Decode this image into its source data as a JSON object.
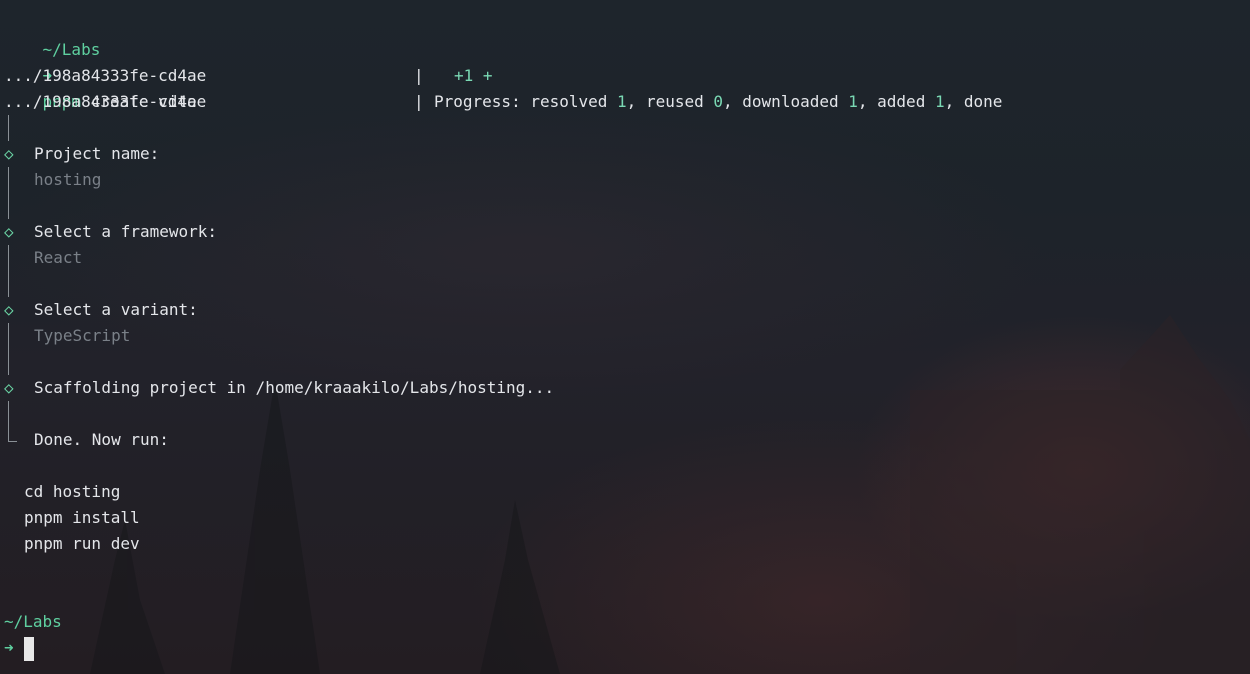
{
  "prompt_dir_1": "~/Labs",
  "cmd_arrow": "➜",
  "cmd_bin": "pnpm",
  "cmd_args": " create vite",
  "prog_path_1": ".../198a84333fe-cd4ae",
  "prog_plus": "+1 +",
  "prog_path_2": ".../198a84333fe-cd4ae",
  "progress": {
    "label": "Progress: resolved ",
    "resolved": "1",
    "reused_label": ", reused ",
    "reused": "0",
    "downloaded_label": ", downloaded ",
    "downloaded": "1",
    "added_label": ", added ",
    "added": "1",
    "done_label": ", done"
  },
  "steps": {
    "diamond": "◇",
    "project_name_label": "Project name:",
    "project_name_value": "hosting",
    "framework_label": "Select a framework:",
    "framework_value": "React",
    "variant_label": "Select a variant:",
    "variant_value": "TypeScript",
    "scaffold_label": "Scaffolding project in /home/kraaakilo/Labs/hosting...",
    "done_label": "Done. Now run:"
  },
  "next_commands": [
    "cd hosting",
    "pnpm install",
    "pnpm run dev"
  ],
  "prompt_dir_2": "~/Labs",
  "prompt_arrow_2": "➜"
}
